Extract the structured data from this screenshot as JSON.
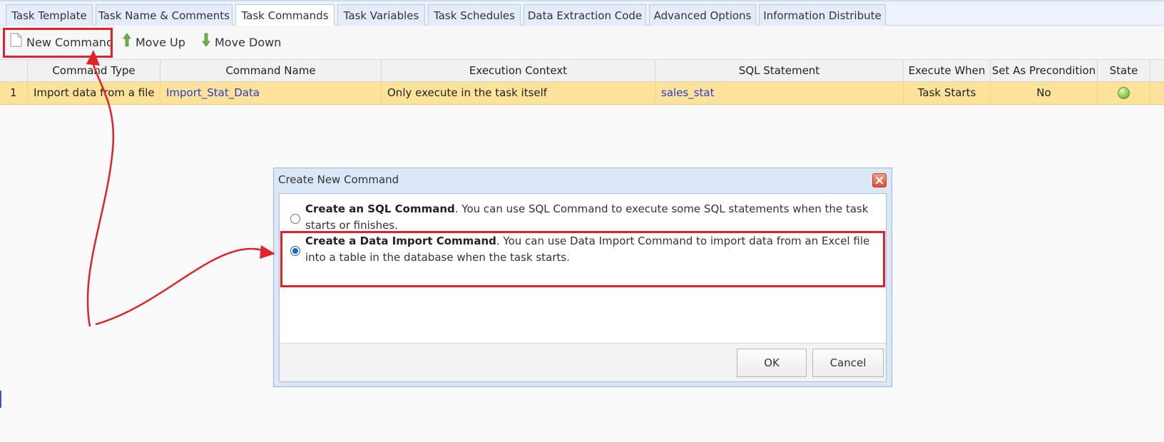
{
  "tabs": [
    {
      "label": "Task Template",
      "active": false
    },
    {
      "label": "Task Name & Comments",
      "active": false
    },
    {
      "label": "Task Commands",
      "active": true
    },
    {
      "label": "Task Variables",
      "active": false
    },
    {
      "label": "Task Schedules",
      "active": false
    },
    {
      "label": "Data Extraction Code",
      "active": false
    },
    {
      "label": "Advanced Options",
      "active": false
    },
    {
      "label": "Information Distribute",
      "active": false
    }
  ],
  "toolbar": {
    "new_command": "New Command",
    "move_up": "Move Up",
    "move_down": "Move Down"
  },
  "grid": {
    "headers": [
      "Command Type",
      "Command Name",
      "Execution Context",
      "SQL Statement",
      "Execute When",
      "Set As Precondition",
      "State"
    ],
    "rows": [
      {
        "index": "1",
        "command_type": "Import data from a file",
        "command_name": "Import_Stat_Data",
        "execution_context": "Only execute in the task itself",
        "sql_statement": "sales_stat",
        "execute_when": "Task Starts",
        "precondition": "No",
        "state_icon": "green-status-dot"
      }
    ]
  },
  "dialog": {
    "title": "Create New Command",
    "option_sql_bold": "Create an SQL Command",
    "option_sql_text": ". You can use SQL Command to execute some SQL statements when the task starts or finishes.",
    "option_sql_selected": false,
    "option_import_bold": "Create a Data Import Command",
    "option_import_text": ". You can use Data Import Command to import data from an Excel file into a table in the database when the task starts.",
    "option_import_selected": true,
    "ok_label": "OK",
    "cancel_label": "Cancel"
  },
  "colors": {
    "highlight_row": "#fde39a",
    "annotation_red": "#e0222a",
    "link_blue": "#2a3bd0",
    "tab_bar": "#eef3fb"
  }
}
